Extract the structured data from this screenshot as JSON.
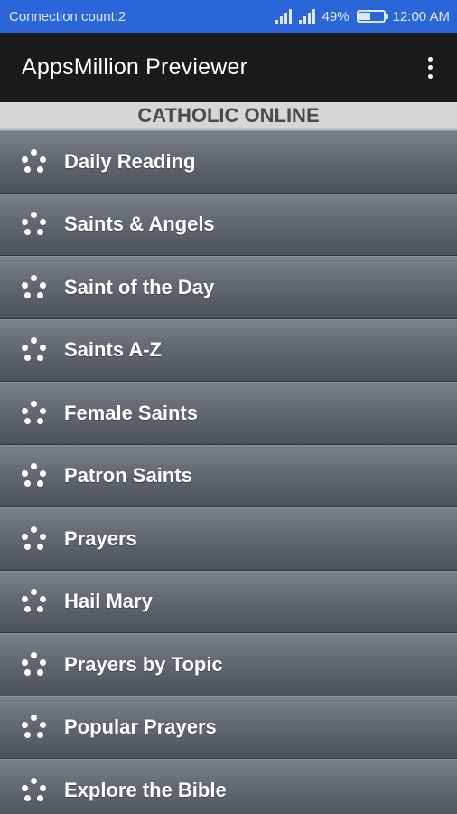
{
  "status_bar": {
    "left_text": "Connection count:2",
    "battery": "49%",
    "battery_level": 0.49,
    "time": "12:00 AM"
  },
  "app_bar": {
    "title": "AppsMillion Previewer",
    "menu_icon": "overflow-menu-icon"
  },
  "section": {
    "title": "CATHOLIC ONLINE"
  },
  "menu": {
    "item_icon": "dots-cluster-icon",
    "items": [
      {
        "label": "Daily Reading"
      },
      {
        "label": "Saints & Angels"
      },
      {
        "label": "Saint of the Day"
      },
      {
        "label": "Saints A-Z"
      },
      {
        "label": "Female Saints"
      },
      {
        "label": "Patron Saints"
      },
      {
        "label": "Prayers"
      },
      {
        "label": "Hail Mary"
      },
      {
        "label": "Prayers by Topic"
      },
      {
        "label": "Popular Prayers"
      },
      {
        "label": "Explore the Bible"
      }
    ]
  },
  "colors": {
    "status_bar": "#2b66d9",
    "app_bar": "#1a1a1a",
    "section_header": "#d6d6d6",
    "menu_item": "#646b72"
  }
}
